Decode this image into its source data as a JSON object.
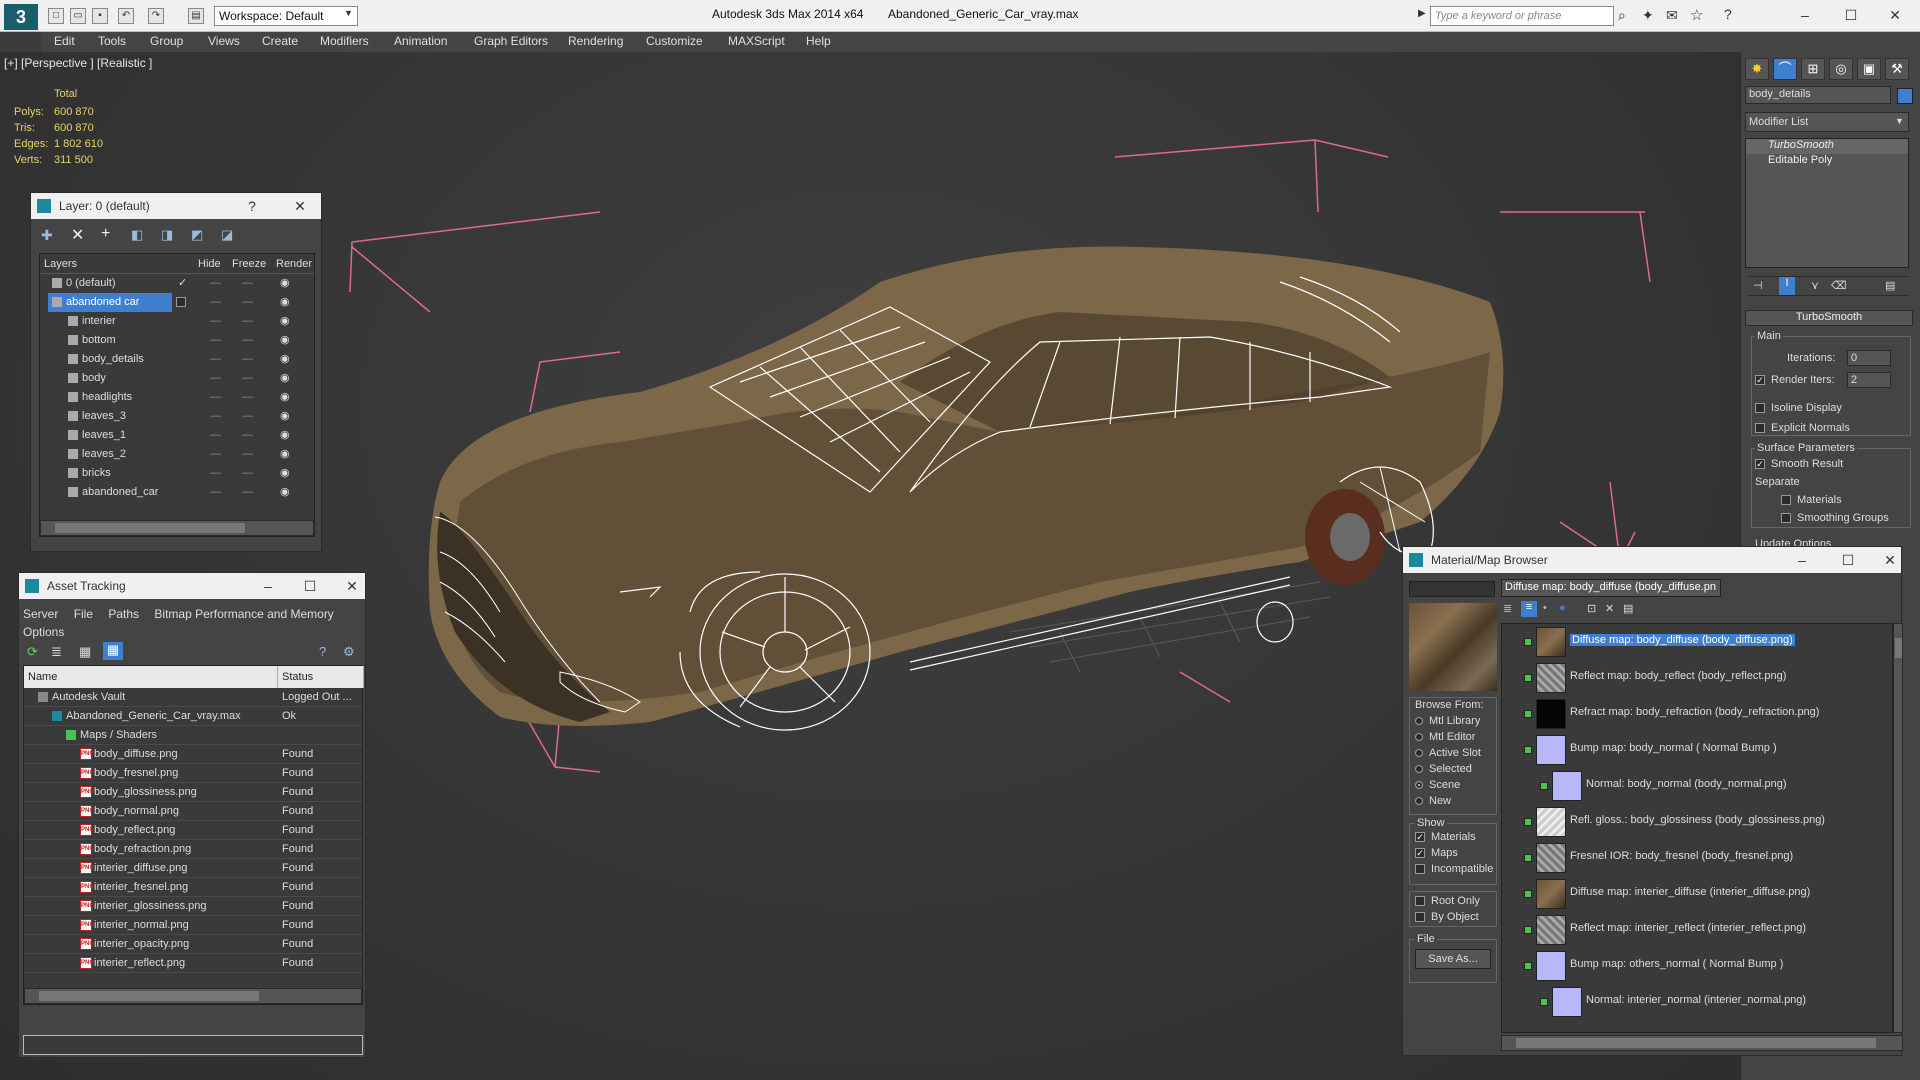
{
  "titlebar": {
    "app_title": "Autodesk 3ds Max  2014 x64",
    "file_title": "Abandoned_Generic_Car_vray.max",
    "workspace": "Workspace: Default",
    "search_placeholder": "Type a keyword or phrase",
    "logo": "3"
  },
  "menu": [
    "Edit",
    "Tools",
    "Group",
    "Views",
    "Create",
    "Modifiers",
    "Animation",
    "Graph Editors",
    "Rendering",
    "Customize",
    "MAXScript",
    "Help"
  ],
  "viewport": {
    "label": "[+] [Perspective ] [Realistic ]",
    "stats": {
      "header": "Total",
      "rows": [
        {
          "label": "Polys:",
          "value": "600 870"
        },
        {
          "label": "Tris:",
          "value": "600 870"
        },
        {
          "label": "Edges:",
          "value": "1 802 610"
        },
        {
          "label": "Verts:",
          "value": "311 500"
        }
      ]
    }
  },
  "layer_panel": {
    "title": "Layer: 0 (default)",
    "help": "?",
    "columns": [
      "Layers",
      "Hide",
      "Freeze",
      "Render"
    ],
    "rows": [
      {
        "name": "0 (default)",
        "indent": 1,
        "selected": false,
        "active": true
      },
      {
        "name": "abandoned car",
        "indent": 1,
        "selected": true,
        "active": false
      },
      {
        "name": "interier",
        "indent": 2,
        "selected": false,
        "active": false
      },
      {
        "name": "bottom",
        "indent": 2,
        "selected": false,
        "active": false
      },
      {
        "name": "body_details",
        "indent": 2,
        "selected": false,
        "active": false
      },
      {
        "name": "body",
        "indent": 2,
        "selected": false,
        "active": false
      },
      {
        "name": "headlights",
        "indent": 2,
        "selected": false,
        "active": false
      },
      {
        "name": "leaves_3",
        "indent": 2,
        "selected": false,
        "active": false
      },
      {
        "name": "leaves_1",
        "indent": 2,
        "selected": false,
        "active": false
      },
      {
        "name": "leaves_2",
        "indent": 2,
        "selected": false,
        "active": false
      },
      {
        "name": "bricks",
        "indent": 2,
        "selected": false,
        "active": false
      },
      {
        "name": "abandoned_car",
        "indent": 2,
        "selected": false,
        "active": false
      }
    ]
  },
  "asset_panel": {
    "title": "Asset Tracking",
    "menu": [
      "Server",
      "File",
      "Paths",
      "Bitmap Performance and Memory",
      "Options"
    ],
    "columns": [
      "Name",
      "Status"
    ],
    "rows": [
      {
        "name": "Autodesk Vault",
        "status": "Logged Out ...",
        "type": "vault",
        "indent": 0
      },
      {
        "name": "Abandoned_Generic_Car_vray.max",
        "status": "Ok",
        "type": "max",
        "indent": 1
      },
      {
        "name": "Maps / Shaders",
        "status": "",
        "type": "folder",
        "indent": 2
      },
      {
        "name": "body_diffuse.png",
        "status": "Found",
        "type": "png",
        "indent": 3
      },
      {
        "name": "body_fresnel.png",
        "status": "Found",
        "type": "png",
        "indent": 3
      },
      {
        "name": "body_glossiness.png",
        "status": "Found",
        "type": "png",
        "indent": 3
      },
      {
        "name": "body_normal.png",
        "status": "Found",
        "type": "png",
        "indent": 3
      },
      {
        "name": "body_reflect.png",
        "status": "Found",
        "type": "png",
        "indent": 3
      },
      {
        "name": "body_refraction.png",
        "status": "Found",
        "type": "png",
        "indent": 3
      },
      {
        "name": "interier_diffuse.png",
        "status": "Found",
        "type": "png",
        "indent": 3
      },
      {
        "name": "interier_fresnel.png",
        "status": "Found",
        "type": "png",
        "indent": 3
      },
      {
        "name": "interier_glossiness.png",
        "status": "Found",
        "type": "png",
        "indent": 3
      },
      {
        "name": "interier_normal.png",
        "status": "Found",
        "type": "png",
        "indent": 3
      },
      {
        "name": "interier_opacity.png",
        "status": "Found",
        "type": "png",
        "indent": 3
      },
      {
        "name": "interier_reflect.png",
        "status": "Found",
        "type": "png",
        "indent": 3
      }
    ]
  },
  "command_panel": {
    "object_name": "body_details",
    "modifier_list": "Modifier List",
    "stack": [
      "TurboSmooth",
      "Editable Poly"
    ],
    "rollout_title": "TurboSmooth",
    "main_label": "Main",
    "iterations_label": "Iterations:",
    "iterations_value": "0",
    "render_iters_label": "Render Iters:",
    "render_iters_value": "2",
    "isoline": "Isoline Display",
    "explicit": "Explicit Normals",
    "surface_params": "Surface Parameters",
    "smooth_result": "Smooth Result",
    "separate": "Separate",
    "materials": "Materials",
    "smoothing_groups": "Smoothing Groups",
    "update_options": "Update Options"
  },
  "material_browser": {
    "title": "Material/Map Browser",
    "selected_field": "Diffuse map: body_diffuse (body_diffuse.pn",
    "browse_from_label": "Browse From:",
    "browse_from": [
      "Mtl Library",
      "Mtl Editor",
      "Active Slot",
      "Selected",
      "Scene",
      "New"
    ],
    "browse_selected": "Scene",
    "show_label": "Show",
    "show": [
      {
        "label": "Materials",
        "checked": true
      },
      {
        "label": "Maps",
        "checked": true
      },
      {
        "label": "Incompatible",
        "checked": false
      }
    ],
    "root_only": "Root Only",
    "by_object": "By Object",
    "file_label": "File",
    "save_as": "Save As...",
    "items": [
      {
        "text": "Diffuse map: body_diffuse (body_diffuse.png)",
        "thumb": "rust",
        "indent": 0,
        "selected": true
      },
      {
        "text": "Reflect map: body_reflect (body_reflect.png)",
        "thumb": "grey",
        "indent": 0,
        "selected": false
      },
      {
        "text": "Refract map: body_refraction (body_refraction.png)",
        "thumb": "black",
        "indent": 0,
        "selected": false
      },
      {
        "text": "Bump map: body_normal  ( Normal Bump )",
        "thumb": "lav",
        "indent": 0,
        "selected": false
      },
      {
        "text": "Normal: body_normal (body_normal.png)",
        "thumb": "lav",
        "indent": 1,
        "selected": false
      },
      {
        "text": "Refl. gloss.: body_glossiness (body_glossiness.png)",
        "thumb": "light",
        "indent": 0,
        "selected": false
      },
      {
        "text": "Fresnel IOR: body_fresnel (body_fresnel.png)",
        "thumb": "grey",
        "indent": 0,
        "selected": false
      },
      {
        "text": "Diffuse map: interier_diffuse (interier_diffuse.png)",
        "thumb": "rust",
        "indent": 0,
        "selected": false
      },
      {
        "text": "Reflect map: interier_reflect (interier_reflect.png)",
        "thumb": "grey",
        "indent": 0,
        "selected": false
      },
      {
        "text": "Bump map: others_normal  ( Normal Bump )",
        "thumb": "lav",
        "indent": 0,
        "selected": false
      },
      {
        "text": "Normal: interier_normal (interier_normal.png)",
        "thumb": "lav",
        "indent": 1,
        "selected": false
      }
    ]
  },
  "colors": {
    "selection_blue": "#3f7fd0",
    "stats_yellow": "#e8d268",
    "bbox_pink": "#e06a8a",
    "panel_bg": "#444444"
  }
}
